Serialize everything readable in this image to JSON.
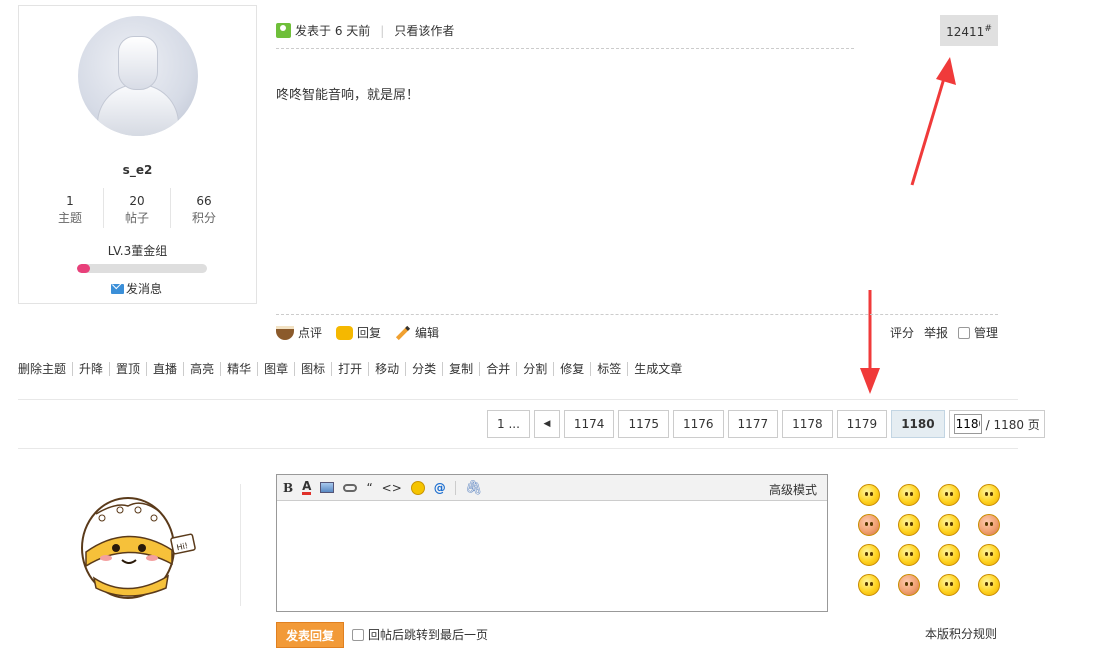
{
  "profile": {
    "username": "s_e2",
    "stats": [
      {
        "value": "1",
        "label": "主题"
      },
      {
        "value": "20",
        "label": "帖子"
      },
      {
        "value": "66",
        "label": "积分"
      }
    ],
    "level": "LV.3董金组",
    "level_progress": 0.1,
    "pm_label": "发消息"
  },
  "post": {
    "posted_at": "发表于 6 天前",
    "only_author": "只看该作者",
    "floor_number": "12411",
    "floor_suffix": "#",
    "content": "咚咚智能音响，就是屌！"
  },
  "post_actions": {
    "comment": "点评",
    "reply": "回复",
    "edit": "编辑",
    "rate": "评分",
    "report": "举报",
    "manage": "管理"
  },
  "mod_tools": [
    "删除主题",
    "升降",
    "置顶",
    "直播",
    "高亮",
    "精华",
    "图章",
    "图标",
    "打开",
    "移动",
    "分类",
    "复制",
    "合并",
    "分割",
    "修复",
    "标签",
    "生成文章"
  ],
  "pagination": {
    "first": "1 ...",
    "pages": [
      "1174",
      "1175",
      "1176",
      "1177",
      "1178",
      "1179"
    ],
    "current": "1180",
    "input_value": "1180",
    "total": "/ 1180 页"
  },
  "editor": {
    "advanced_mode": "高级模式",
    "toolbar": {
      "bold": "B",
      "color": "A",
      "quote": "“",
      "code": "<>",
      "at": "@",
      "attach": "🖇"
    }
  },
  "reply": {
    "submit": "发表回复",
    "jump_last": "回帖后跳转到最后一页",
    "rules": "本版积分规则"
  },
  "colors": {
    "accent_orange": "#f29a38",
    "level_bar": "#e8407a",
    "annotation_arrow": "#f03a3a"
  }
}
